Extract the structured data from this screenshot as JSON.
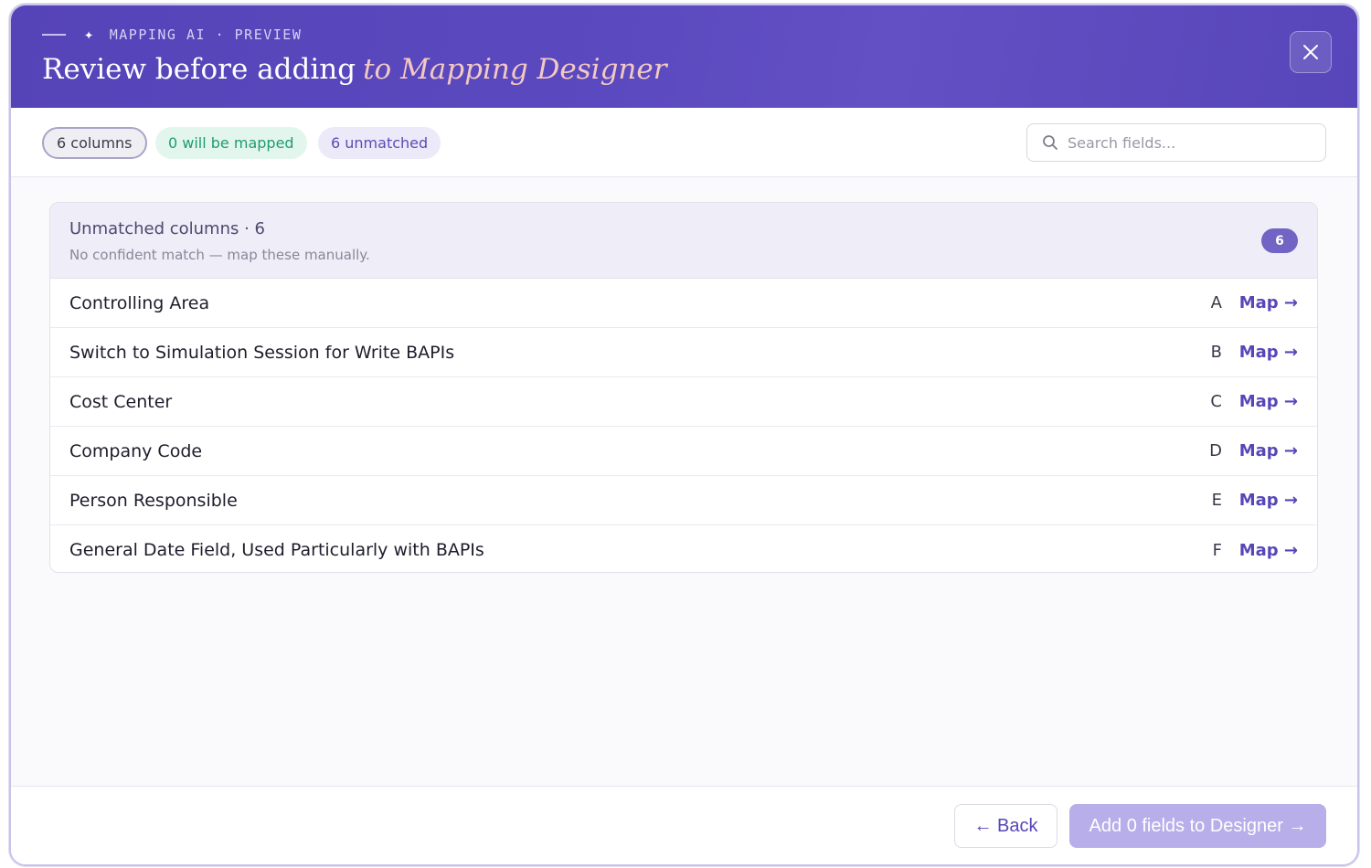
{
  "header": {
    "eyebrow": "MAPPING AI · PREVIEW",
    "title_main": "Review before adding",
    "title_accent": "to Mapping Designer",
    "icons": {
      "spark": "sparkle-icon",
      "close": "close-icon"
    }
  },
  "toolbar": {
    "pills": {
      "columns": "6 columns",
      "mapped": "0 will be mapped",
      "unmatched": "6 unmatched"
    },
    "search": {
      "placeholder": "Search fields...",
      "value": ""
    }
  },
  "group": {
    "title": "Unmatched columns · 6",
    "subtitle": "No confident match — map these manually.",
    "count": "6",
    "rows": [
      {
        "name": "Controlling Area",
        "letter": "A",
        "action": "Map →"
      },
      {
        "name": "Switch to Simulation Session for Write BAPIs",
        "letter": "B",
        "action": "Map →"
      },
      {
        "name": "Cost Center",
        "letter": "C",
        "action": "Map →"
      },
      {
        "name": "Company Code",
        "letter": "D",
        "action": "Map →"
      },
      {
        "name": "Person Responsible",
        "letter": "E",
        "action": "Map →"
      },
      {
        "name": "General Date Field, Used Particularly with BAPIs",
        "letter": "F",
        "action": "Map →"
      }
    ]
  },
  "footer": {
    "back_label": "← Back",
    "add_label": "Add 0 fields to Designer →"
  },
  "colors": {
    "header": "#5543b8",
    "accent": "#5646b8",
    "mapped_green": "#1f9d6b",
    "add_disabled": "#b7aeea"
  }
}
